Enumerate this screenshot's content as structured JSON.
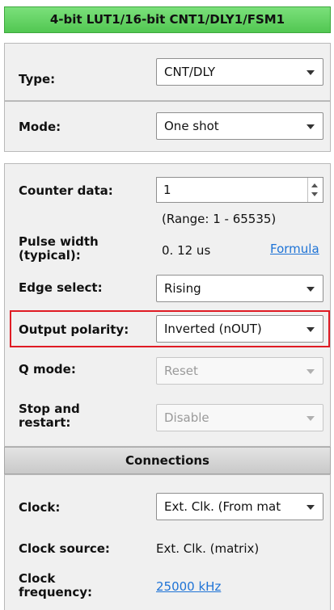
{
  "header": {
    "title": "4-bit LUT1/16-bit CNT1/DLY1/FSM1"
  },
  "type": {
    "label": "Type:",
    "value": "CNT/DLY"
  },
  "mode": {
    "label": "Mode:",
    "value": "One shot"
  },
  "counter": {
    "label": "Counter data:",
    "value": "1",
    "range": "(Range:  1 - 65535)"
  },
  "pulse": {
    "label_line1": "Pulse width",
    "label_line2": "(typical):",
    "value": "0. 12 us",
    "formula_link": "Formula"
  },
  "edge": {
    "label": "Edge select:",
    "value": "Rising"
  },
  "polarity": {
    "label": "Output polarity:",
    "value": "Inverted (nOUT)"
  },
  "qmode": {
    "label": "Q mode:",
    "value": "Reset"
  },
  "stop": {
    "label_line1": "Stop and",
    "label_line2": "restart:",
    "value": "Disable"
  },
  "connections": {
    "title": "Connections"
  },
  "clock": {
    "label": "Clock:",
    "value": "Ext. Clk. (From mat"
  },
  "clock_source": {
    "label": "Clock source:",
    "value": "Ext. Clk. (matrix)"
  },
  "clock_freq": {
    "label_line1": "Clock",
    "label_line2": "frequency:",
    "value": "25000 kHz"
  },
  "colors": {
    "header_green": "#52c752",
    "highlight_red": "#e01b24",
    "link_blue": "#1e73d6"
  }
}
